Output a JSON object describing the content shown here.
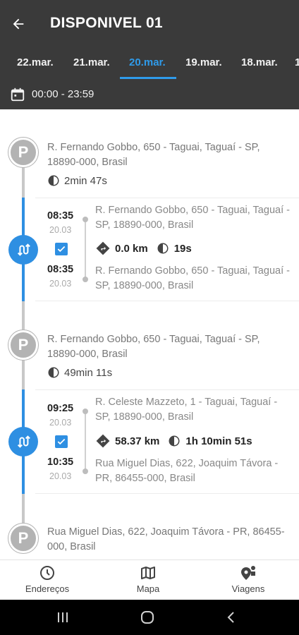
{
  "header": {
    "title": "DISPONIVEL 01",
    "date_tabs": [
      {
        "label": "22.mar."
      },
      {
        "label": "21.mar."
      },
      {
        "label": "20.mar."
      },
      {
        "label": "19.mar."
      },
      {
        "label": "18.mar."
      }
    ],
    "active_tab_index": 2,
    "time_range": "00:00 - 23:59"
  },
  "timeline": {
    "stops": [
      {
        "marker": "P",
        "address": "R. Fernando Gobbo, 650 - Taguai, Taguaí - SP, 18890-000, Brasil",
        "duration": "2min 47s"
      },
      {
        "marker": "P",
        "address": "R. Fernando Gobbo, 650 - Taguai, Taguaí - SP, 18890-000, Brasil",
        "duration": "49min 11s"
      },
      {
        "marker": "P",
        "address": "Rua Miguel Dias, 622, Joaquim Távora - PR, 86455-000, Brasil"
      }
    ],
    "trips": [
      {
        "start_time": "08:35",
        "start_date": "20.03",
        "start_address": "R. Fernando Gobbo, 650 - Taguai, Taguaí - SP, 18890-000, Brasil",
        "distance": "0.0 km",
        "duration": "19s",
        "end_time": "08:35",
        "end_date": "20.03",
        "end_address": "R. Fernando Gobbo, 650 - Taguai, Taguaí - SP, 18890-000, Brasil",
        "checked": true
      },
      {
        "start_time": "09:25",
        "start_date": "20.03",
        "start_address": "R. Celeste Mazzeto, 1 - Taguai, Taguaí - SP, 18890-000, Brasil",
        "distance": "58.37 km",
        "duration": "1h 10min 51s",
        "end_time": "10:35",
        "end_date": "20.03",
        "end_address": "Rua Miguel Dias, 622, Joaquim Távora - PR, 86455-000, Brasil",
        "checked": true
      }
    ]
  },
  "bottom_nav": {
    "items": [
      {
        "label": "Endereços",
        "icon": "clock-icon"
      },
      {
        "label": "Mapa",
        "icon": "map-icon"
      },
      {
        "label": "Viagens",
        "icon": "trips-icon"
      }
    ]
  },
  "colors": {
    "appbar": "#3a3a3a",
    "accent": "#2e8fe2",
    "parking_marker": "#b3b3b3"
  }
}
